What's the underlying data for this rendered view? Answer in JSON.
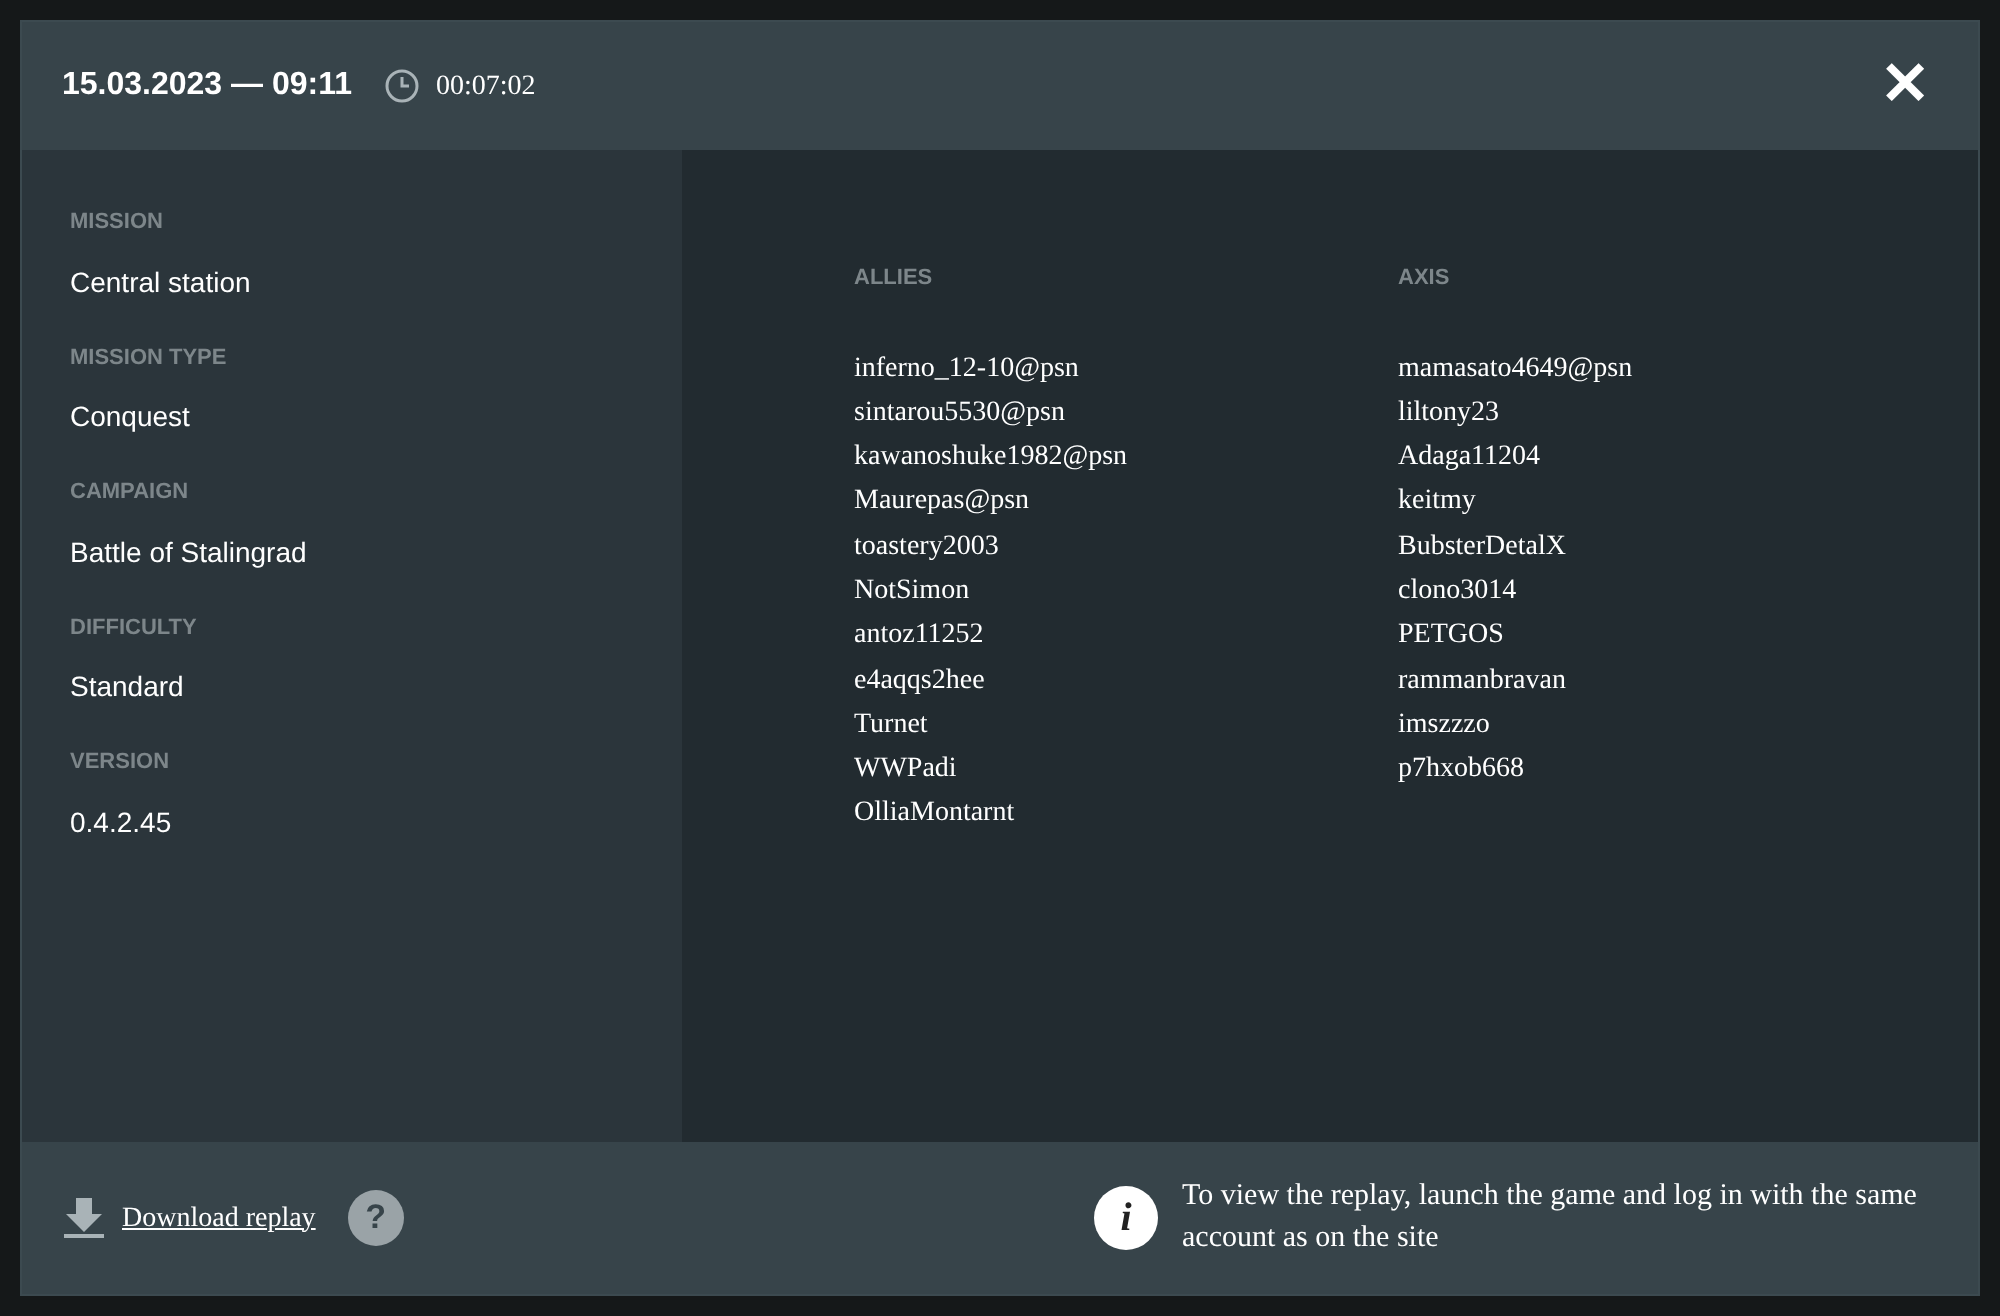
{
  "header": {
    "date": "15.03.2023 — 09:11",
    "duration": "00:07:02",
    "close": "✕"
  },
  "details": [
    {
      "label": "MISSION",
      "value": "Central station"
    },
    {
      "label": "MISSION TYPE",
      "value": "Conquest"
    },
    {
      "label": "CAMPAIGN",
      "value": "Battle of Stalingrad"
    },
    {
      "label": "DIFFICULTY",
      "value": "Standard"
    },
    {
      "label": "VERSION",
      "value": "0.4.2.45"
    }
  ],
  "teams": [
    {
      "name": "ALLIES",
      "players": [
        "inferno_12-10@psn",
        "sintarou5530@psn",
        "kawanoshuke1982@psn",
        "Maurepas@psn",
        "toastery2003",
        "NotSimon",
        "antoz11252",
        "e4aqqs2hee",
        "Turnet",
        "WWPadi",
        "OlliaMontarnt"
      ]
    },
    {
      "name": "AXIS",
      "players": [
        "mamasato4649@psn",
        "liltony23",
        "Adaga11204",
        "keitmy",
        "BubsterDetalX",
        "clono3014",
        "PETGOS",
        "rammanbravan",
        "imszzzo",
        "p7hxob668"
      ]
    }
  ],
  "footer": {
    "download": "Download replay",
    "help": "?",
    "info_icon": "i",
    "info": "To view the replay, launch the game and log in with the same account as on the site"
  }
}
